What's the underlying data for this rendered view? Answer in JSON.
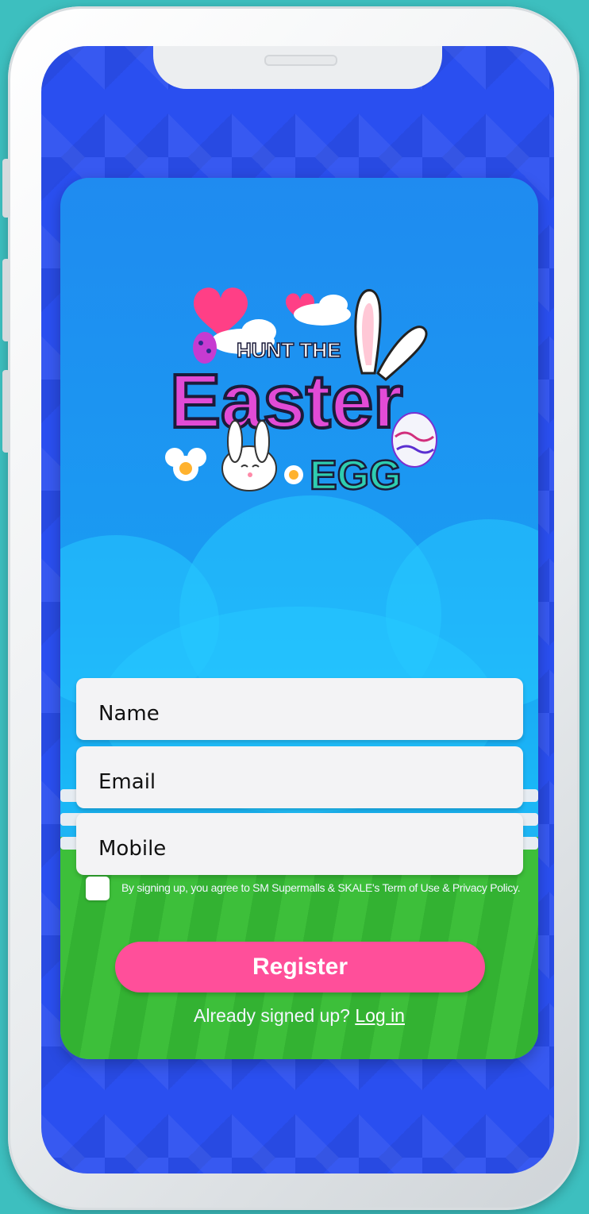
{
  "form": {
    "name_placeholder": "Name",
    "email_placeholder": "Email",
    "mobile_placeholder": "Mobile",
    "consent_text": "By signing up, you agree to SM Supermalls & SKALE's Term of Use & Privacy Policy.",
    "consent_checked": false,
    "register_label": "Register",
    "already_signed_up": "Already signed up?",
    "login_label": "Log in"
  },
  "logo": {
    "line1": "HUNT THE",
    "line2": "Easter",
    "line3": "EGG",
    "letter_colors": [
      "#e24bd6",
      "#ff5da8",
      "#7b5cff",
      "#ffd23d",
      "#ffffff",
      "#6a6cff"
    ],
    "egg_color": "#ffb1c4"
  },
  "colors": {
    "background": "#3dbfbf",
    "screen": "#2a4ff0",
    "card_top": "#1f8bf0",
    "grass": "#3dbf3a",
    "register_button": "#ff4f9a",
    "heart": "#ff3f86"
  },
  "icons": [
    "heart-icon",
    "cloud-icon",
    "bunny-icon",
    "flower-icon",
    "easter-egg-icon",
    "checkbox-icon"
  ]
}
